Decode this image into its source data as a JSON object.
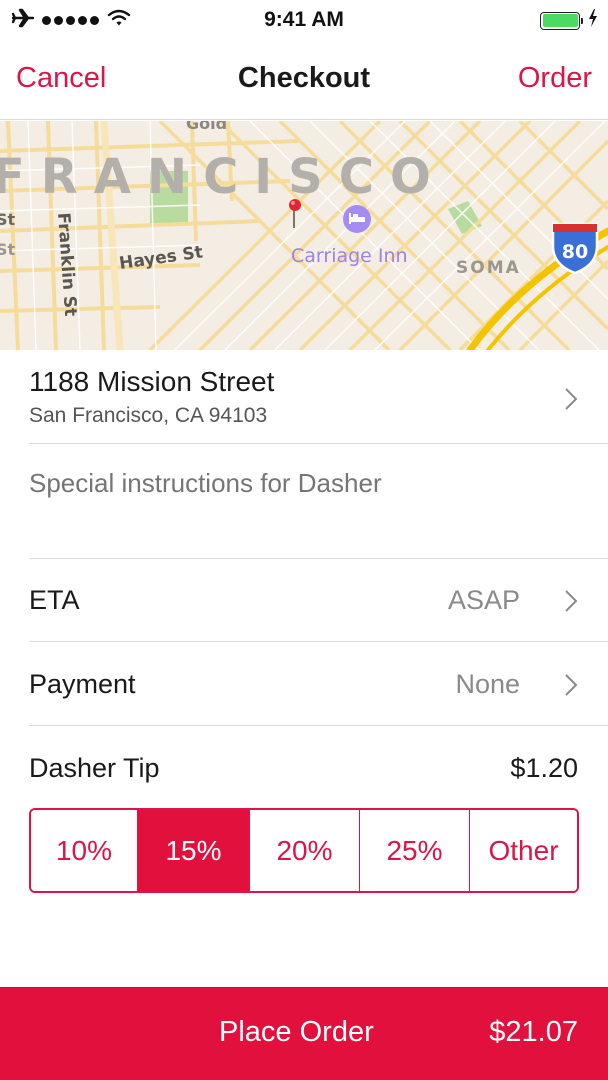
{
  "status_bar": {
    "time": "9:41 AM",
    "icons": [
      "airplane-icon",
      "signal-dots-icon",
      "wifi-icon",
      "battery-icon",
      "charging-bolt-icon"
    ],
    "signal_bars": 5,
    "battery_level_percent": 100
  },
  "nav": {
    "left_label": "Cancel",
    "title": "Checkout",
    "right_label": "Order"
  },
  "map": {
    "labels": {
      "city": "FRANCISCO",
      "top_partial": "Gold",
      "left_partial_1": "St",
      "left_partial_2": "St",
      "franklin": "Franklin St",
      "hayes": "Hayes St",
      "poi": "Carriage Inn",
      "district": "SOMA",
      "highway_shield": "80"
    },
    "icons": [
      "map-pin-icon",
      "hotel-bed-icon",
      "interstate-shield-icon"
    ]
  },
  "address": {
    "line1": "1188 Mission Street",
    "line2": "San Francisco, CA 94103"
  },
  "instructions": {
    "placeholder": "Special instructions for Dasher",
    "value": ""
  },
  "eta": {
    "label": "ETA",
    "value": "ASAP"
  },
  "payment": {
    "label": "Payment",
    "value": "None"
  },
  "tip": {
    "label": "Dasher Tip",
    "amount": "$1.20",
    "options": [
      {
        "label": "10%",
        "selected": false
      },
      {
        "label": "15%",
        "selected": true
      },
      {
        "label": "20%",
        "selected": false
      },
      {
        "label": "25%",
        "selected": false
      },
      {
        "label": "Other",
        "selected": false
      }
    ]
  },
  "footer": {
    "button_label": "Place Order",
    "total": "$21.07"
  },
  "colors": {
    "accent": "#dc1447",
    "accent_fill": "#e2103d",
    "secondary_text": "#8a8a8a",
    "battery": "#4cd964"
  }
}
